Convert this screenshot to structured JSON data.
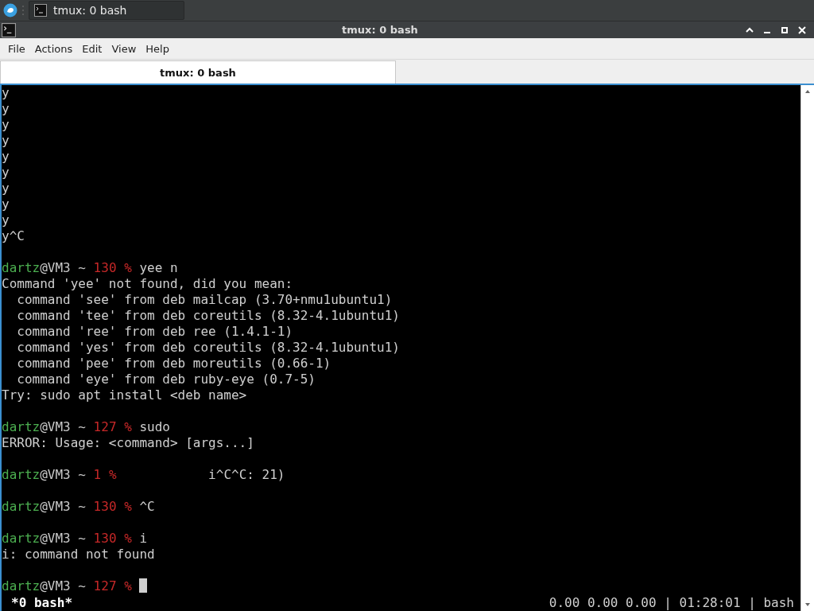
{
  "taskbar": {
    "task": {
      "label": "tmux: 0 bash",
      "selected": true
    }
  },
  "window": {
    "title": "tmux: 0 bash"
  },
  "menu": [
    "File",
    "Actions",
    "Edit",
    "View",
    "Help"
  ],
  "tabs": [
    {
      "label": "tmux: 0 bash",
      "selected": true
    }
  ],
  "terminal": {
    "lines": [
      {
        "kind": "output",
        "text": "y"
      },
      {
        "kind": "output",
        "text": "y"
      },
      {
        "kind": "output",
        "text": "y"
      },
      {
        "kind": "output",
        "text": "y"
      },
      {
        "kind": "output",
        "text": "y"
      },
      {
        "kind": "output",
        "text": "y"
      },
      {
        "kind": "output",
        "text": "y"
      },
      {
        "kind": "output",
        "text": "y"
      },
      {
        "kind": "output",
        "text": "y"
      },
      {
        "kind": "output",
        "text": "y^C"
      },
      {
        "kind": "blank"
      },
      {
        "kind": "prompt",
        "user": "dartz",
        "host": "@VM3 ~",
        "status": "130 %",
        "command": "yee n"
      },
      {
        "kind": "output",
        "text": "Command 'yee' not found, did you mean:"
      },
      {
        "kind": "output",
        "text": "  command 'see' from deb mailcap (3.70+nmu1ubuntu1)"
      },
      {
        "kind": "output",
        "text": "  command 'tee' from deb coreutils (8.32-4.1ubuntu1)"
      },
      {
        "kind": "output",
        "text": "  command 'ree' from deb ree (1.4.1-1)"
      },
      {
        "kind": "output",
        "text": "  command 'yes' from deb coreutils (8.32-4.1ubuntu1)"
      },
      {
        "kind": "output",
        "text": "  command 'pee' from deb moreutils (0.66-1)"
      },
      {
        "kind": "output",
        "text": "  command 'eye' from deb ruby-eye (0.7-5)"
      },
      {
        "kind": "output",
        "text": "Try: sudo apt install <deb name>"
      },
      {
        "kind": "blank"
      },
      {
        "kind": "prompt",
        "user": "dartz",
        "host": "@VM3 ~",
        "status": "127 %",
        "command": "sudo"
      },
      {
        "kind": "output",
        "text": "ERROR: Usage: <command> [args...]"
      },
      {
        "kind": "blank"
      },
      {
        "kind": "prompt",
        "user": "dartz",
        "host": "@VM3 ~",
        "status": "1 %",
        "command": "           i^C^C: 21)"
      },
      {
        "kind": "blank"
      },
      {
        "kind": "prompt",
        "user": "dartz",
        "host": "@VM3 ~",
        "status": "130 %",
        "command": "^C"
      },
      {
        "kind": "blank"
      },
      {
        "kind": "prompt",
        "user": "dartz",
        "host": "@VM3 ~",
        "status": "130 %",
        "command": "i"
      },
      {
        "kind": "output",
        "text": "i: command not found"
      },
      {
        "kind": "blank"
      },
      {
        "kind": "prompt",
        "user": "dartz",
        "host": "@VM3 ~",
        "status": "127 %",
        "cursor": true
      }
    ]
  },
  "status_bar": {
    "window": "*0 bash*",
    "info": "0.00 0.00 0.00 | 01:28:01 | bash"
  }
}
